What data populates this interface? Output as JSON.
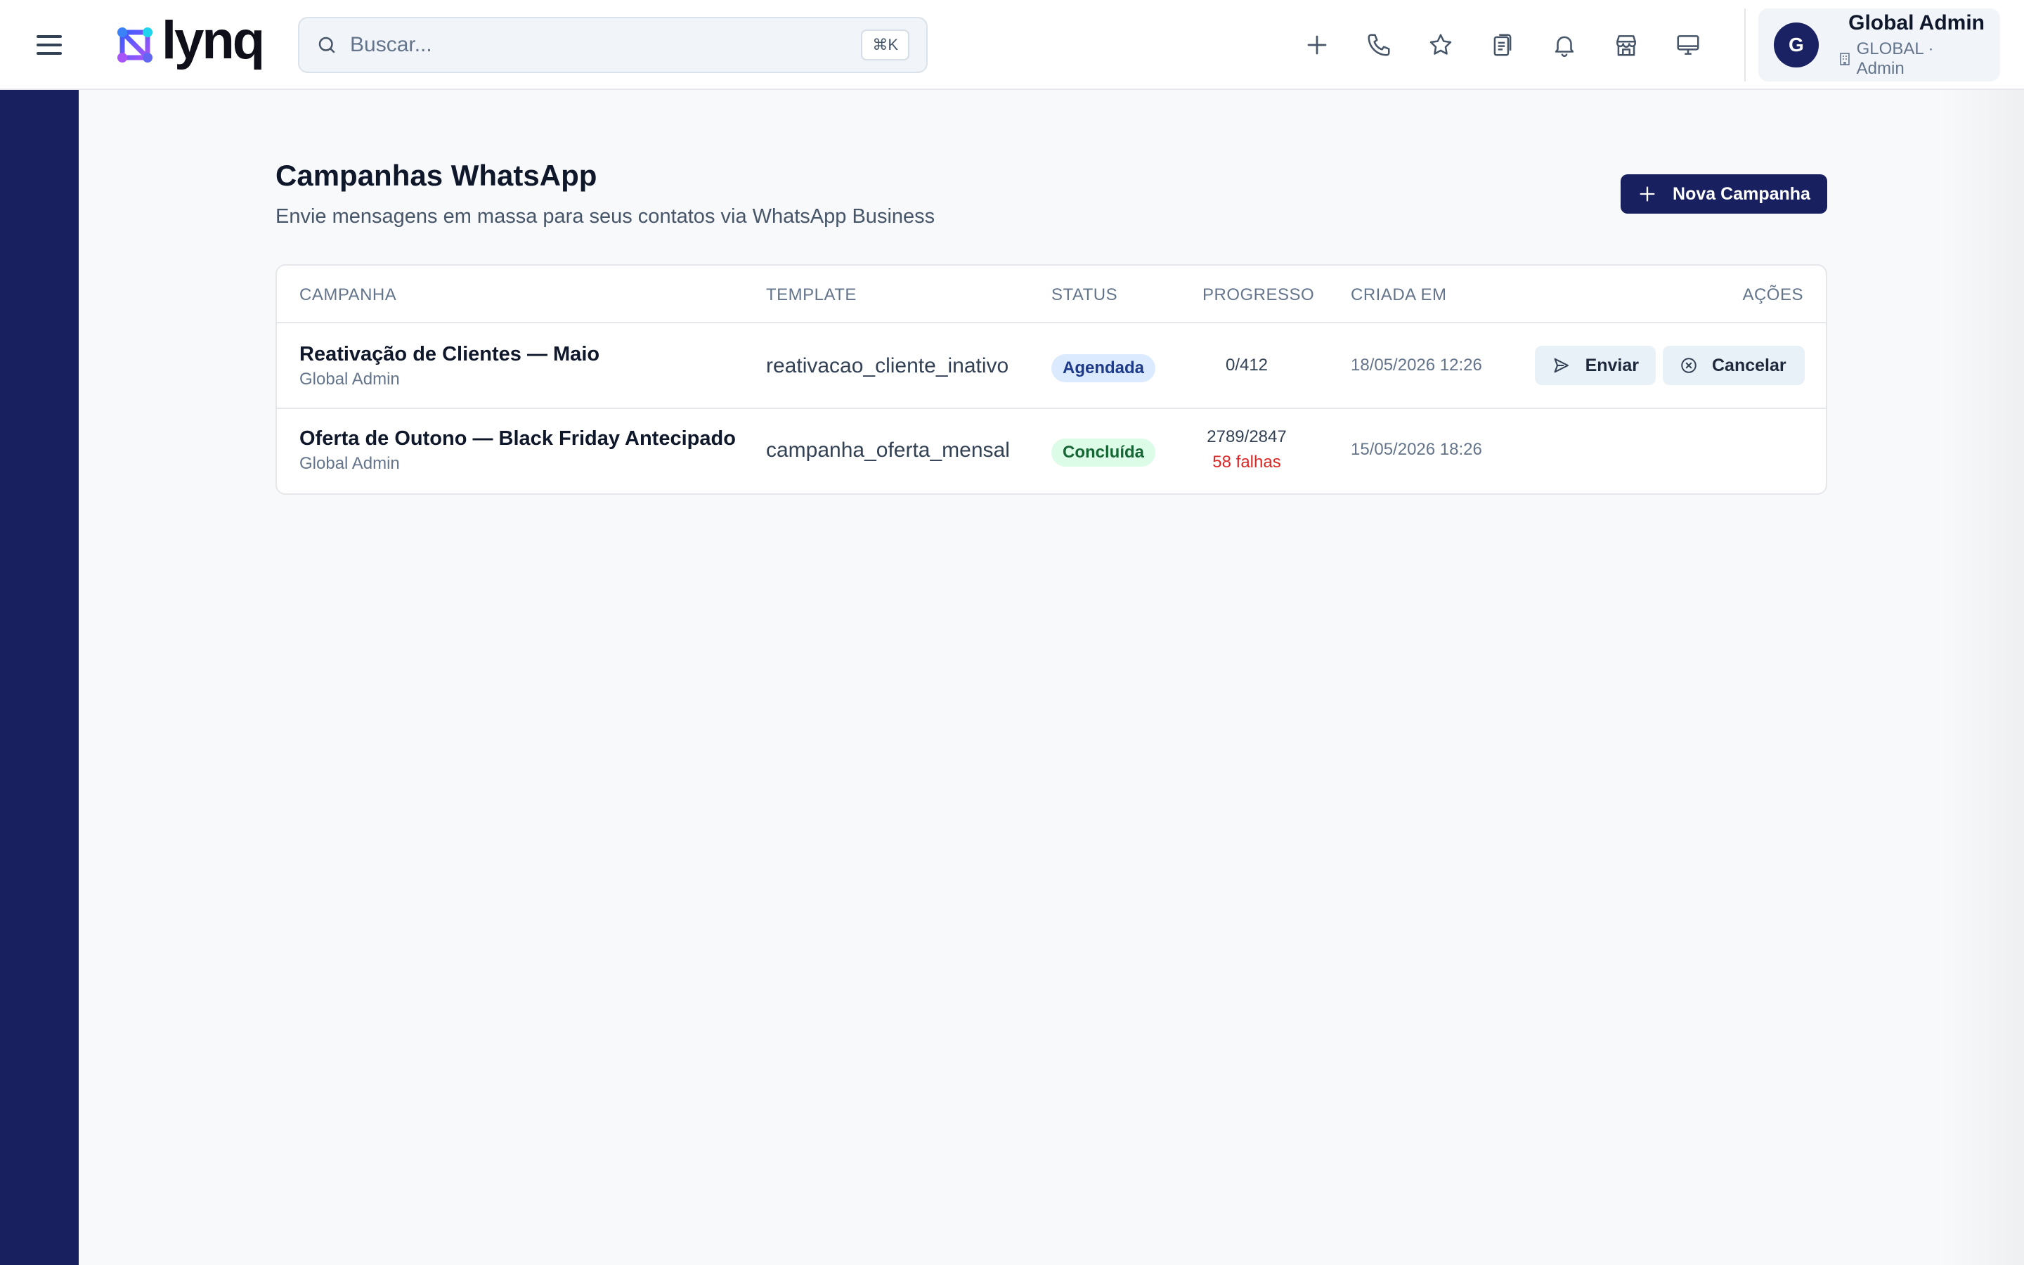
{
  "app": {
    "brand": "lynq"
  },
  "search": {
    "placeholder": "Buscar...",
    "shortcut": "⌘K"
  },
  "toolbar_icons": [
    "plus-icon",
    "phone-icon",
    "star-icon",
    "clipboard-icon",
    "bell-icon",
    "store-icon",
    "monitor-icon"
  ],
  "user": {
    "initial": "G",
    "name": "Global Admin",
    "scope": "GLOBAL · Admin"
  },
  "page": {
    "title": "Campanhas WhatsApp",
    "subtitle": "Envie mensagens em massa para seus contatos via WhatsApp Business",
    "new_button": "Nova Campanha"
  },
  "table": {
    "headers": {
      "campaign": "CAMPANHA",
      "template": "TEMPLATE",
      "status": "STATUS",
      "progress": "PROGRESSO",
      "created": "CRIADA EM",
      "actions": "AÇÕES"
    },
    "rows": [
      {
        "name": "Reativação de Clientes — Maio",
        "owner": "Global Admin",
        "template": "reativacao_cliente_inativo",
        "status": "Agendada",
        "progress": "0/412",
        "created": "18/05/2026 12:26",
        "actions": {
          "send": "Enviar",
          "cancel": "Cancelar"
        }
      },
      {
        "name": "Oferta de Outono — Black Friday Antecipado",
        "owner": "Global Admin",
        "template": "campanha_oferta_mensal",
        "status": "Concluída",
        "progress": "2789/2847",
        "failures": "58 falhas",
        "created": "15/05/2026 18:26"
      }
    ]
  },
  "colors": {
    "sidebar": "#18205f",
    "primary_button": "#18205f",
    "badge_scheduled_bg": "#dbeafe",
    "badge_scheduled_text": "#1e3a8a",
    "badge_done_bg": "#dcfce7",
    "badge_done_text": "#166534",
    "failure_text": "#dc2626"
  }
}
